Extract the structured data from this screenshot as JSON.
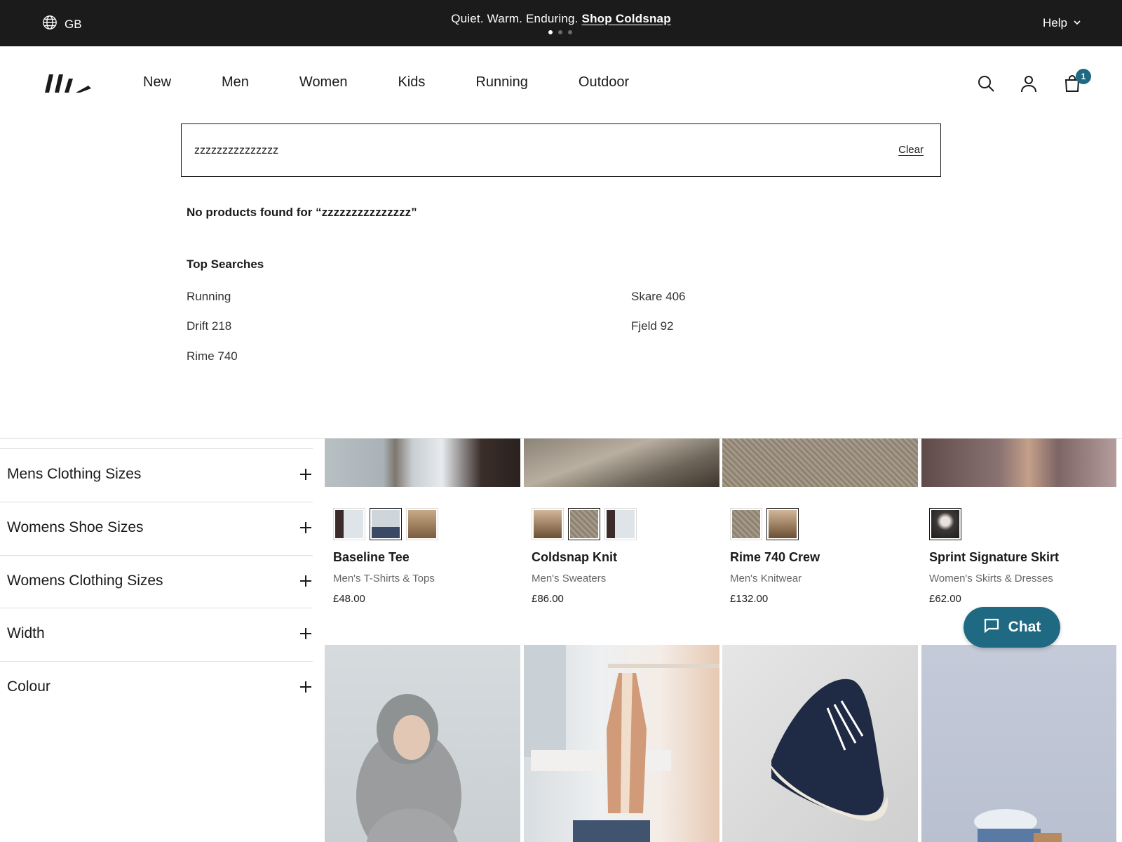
{
  "announcement": {
    "region": "GB",
    "message": "Quiet. Warm. Enduring.",
    "link": "Shop Coldsnap",
    "help": "Help"
  },
  "nav": {
    "items": [
      "New",
      "Men",
      "Women",
      "Kids",
      "Running",
      "Outdoor"
    ]
  },
  "cart": {
    "count": "1"
  },
  "search": {
    "value": "zzzzzzzzzzzzzzz",
    "clear_label": "Clear",
    "no_results": "No products found for “zzzzzzzzzzzzzzz”"
  },
  "top_searches": {
    "title": "Top Searches",
    "items": [
      "Running",
      "Skare 406",
      "Drift 218",
      "Fjeld 92",
      "Rime 740"
    ]
  },
  "filters": [
    "Mens Clothing Sizes",
    "Womens Shoe Sizes",
    "Womens Clothing Sizes",
    "Width",
    "Colour"
  ],
  "products": [
    {
      "name": "Baseline Tee",
      "category": "Men's T-Shirts & Tops",
      "price": "£48.00"
    },
    {
      "name": "Coldsnap Knit",
      "category": "Men's Sweaters",
      "price": "£86.00"
    },
    {
      "name": "Rime 740 Crew",
      "category": "Men's Knitwear",
      "price": "£132.00"
    },
    {
      "name": "Sprint Signature Skirt",
      "category": "Women's Skirts & Dresses",
      "price": "£62.00"
    }
  ],
  "chat": {
    "label": "Chat"
  },
  "colors": {
    "accent": "#1f6a82",
    "topbar": "#1b1b1b"
  }
}
